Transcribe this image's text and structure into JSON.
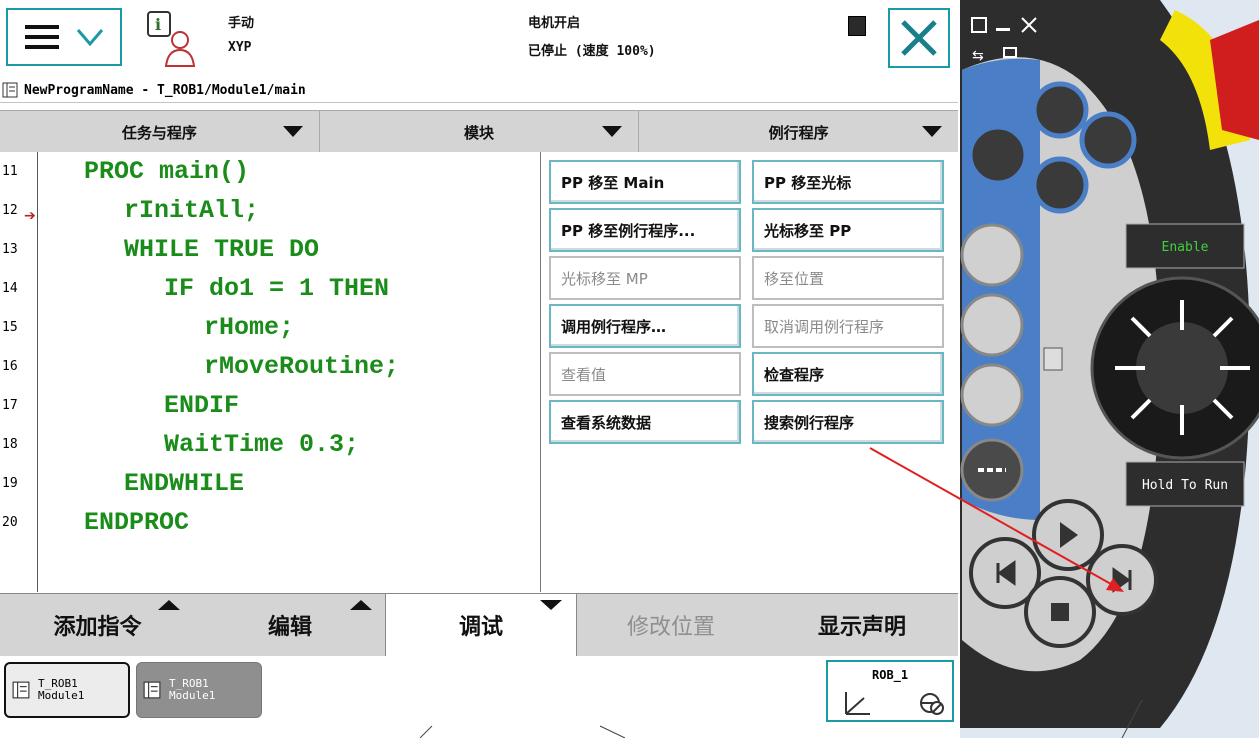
{
  "header": {
    "mode": "手动",
    "system": "XYP",
    "motor_status": "电机开启",
    "run_status": "已停止 (速度 100%)"
  },
  "path": "NewProgramName - T_ROB1/Module1/main",
  "tabs": [
    {
      "label": "任务与程序"
    },
    {
      "label": "模块"
    },
    {
      "label": "例行程序"
    }
  ],
  "code": {
    "line_numbers": [
      "11",
      "12",
      "13",
      "14",
      "15",
      "16",
      "17",
      "18",
      "19",
      "20"
    ],
    "lines": [
      "PROC main()",
      "rInitAll;",
      "WHILE TRUE DO",
      "IF do1 = 1 THEN",
      "rHome;",
      "rMoveRoutine;",
      "ENDIF",
      "WaitTime 0.3;",
      "ENDWHILE",
      "ENDPROC"
    ],
    "text_color": "#1a8c1a"
  },
  "debug_menu": [
    {
      "label": "PP 移至 Main",
      "enabled": true
    },
    {
      "label": "PP 移至光标",
      "enabled": true
    },
    {
      "label": "PP 移至例行程序...",
      "enabled": true
    },
    {
      "label": "光标移至 PP",
      "enabled": true
    },
    {
      "label": "光标移至 MP",
      "enabled": false
    },
    {
      "label": "移至位置",
      "enabled": false
    },
    {
      "label": "调用例行程序…",
      "enabled": true
    },
    {
      "label": "取消调用例行程序",
      "enabled": false
    },
    {
      "label": "查看值",
      "enabled": false
    },
    {
      "label": "检查程序",
      "enabled": true
    },
    {
      "label": "查看系统数据",
      "enabled": true
    },
    {
      "label": "搜索例行程序",
      "enabled": true
    }
  ],
  "command_bar": [
    {
      "label": "添加指令"
    },
    {
      "label": "编辑"
    },
    {
      "label": "调试"
    },
    {
      "label": "修改位置"
    },
    {
      "label": "显示声明"
    }
  ],
  "taskbar": {
    "tasks": [
      {
        "line1": "T_ROB1",
        "line2": "Module1"
      },
      {
        "line1": "T_ROB1",
        "line2": "Module1"
      }
    ],
    "robot": "ROB_1"
  },
  "pendant": {
    "enable_label": "Enable",
    "hold_label": "Hold To Run"
  }
}
